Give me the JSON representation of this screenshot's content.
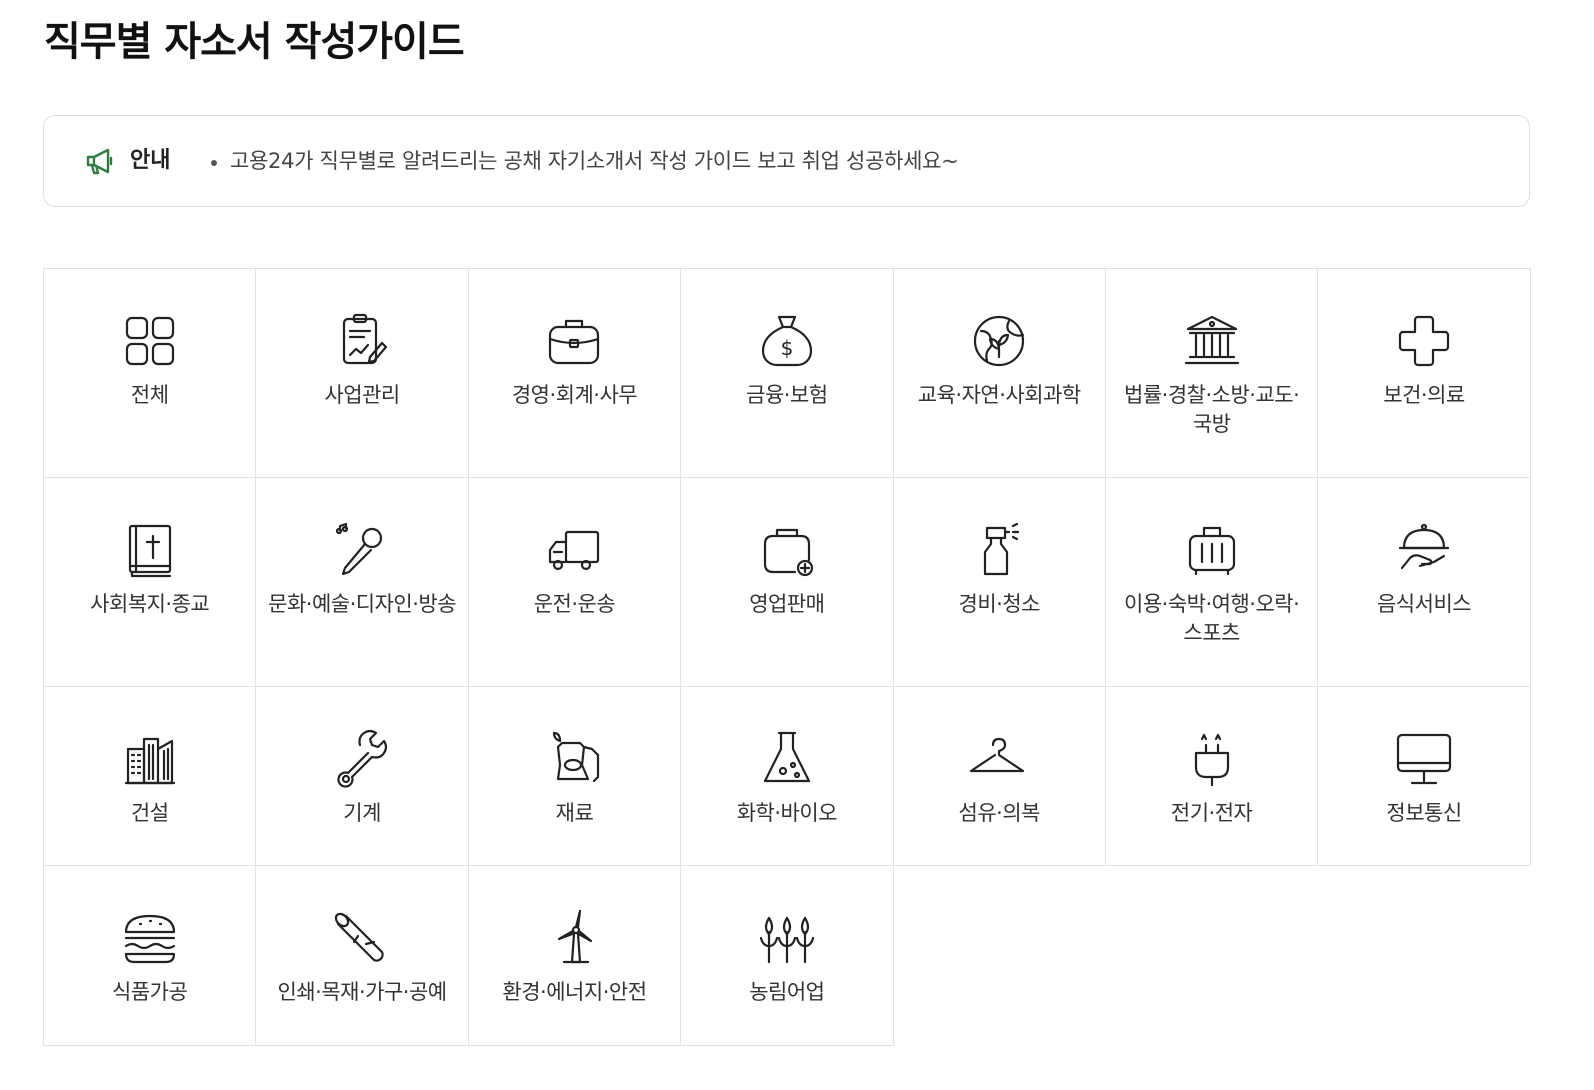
{
  "page": {
    "title": "직무별 자소서 작성가이드"
  },
  "notice": {
    "label": "안내",
    "text": "고용24가 직무별로 알려드리는 공채 자기소개서 작성 가이드 보고 취업 성공하세요~",
    "icon": "megaphone-icon",
    "icon_color": "#2f7d3f"
  },
  "categories": [
    {
      "label": "전체",
      "icon": "grid-icon"
    },
    {
      "label": "사업관리",
      "icon": "clipboard-chart-icon"
    },
    {
      "label": "경영·회계·사무",
      "icon": "briefcase-icon"
    },
    {
      "label": "금융·보험",
      "icon": "money-bag-icon"
    },
    {
      "label": "교육·자연·사회과학",
      "icon": "globe-leaf-icon"
    },
    {
      "label": "법률·경찰·소방·교도·국방",
      "icon": "courthouse-icon"
    },
    {
      "label": "보건·의료",
      "icon": "medical-cross-icon"
    },
    {
      "label": "사회복지·종교",
      "icon": "bible-icon"
    },
    {
      "label": "문화·예술·디자인·방송",
      "icon": "microphone-icon"
    },
    {
      "label": "운전·운송",
      "icon": "truck-icon"
    },
    {
      "label": "영업판매",
      "icon": "shopping-bag-icon"
    },
    {
      "label": "경비·청소",
      "icon": "spray-bottle-icon"
    },
    {
      "label": "이용·숙박·여행·오락·스포츠",
      "icon": "suitcase-icon"
    },
    {
      "label": "음식서비스",
      "icon": "cloche-icon"
    },
    {
      "label": "건설",
      "icon": "buildings-icon"
    },
    {
      "label": "기계",
      "icon": "wrench-icon"
    },
    {
      "label": "재료",
      "icon": "material-sack-icon"
    },
    {
      "label": "화학·바이오",
      "icon": "flask-icon"
    },
    {
      "label": "섬유·의복",
      "icon": "hanger-icon"
    },
    {
      "label": "전기·전자",
      "icon": "plug-icon"
    },
    {
      "label": "정보통신",
      "icon": "monitor-icon"
    },
    {
      "label": "식품가공",
      "icon": "burger-icon"
    },
    {
      "label": "인쇄·목재·가구·공예",
      "icon": "wood-log-icon"
    },
    {
      "label": "환경·에너지·안전",
      "icon": "wind-turbine-icon"
    },
    {
      "label": "농림어업",
      "icon": "crops-icon"
    }
  ]
}
